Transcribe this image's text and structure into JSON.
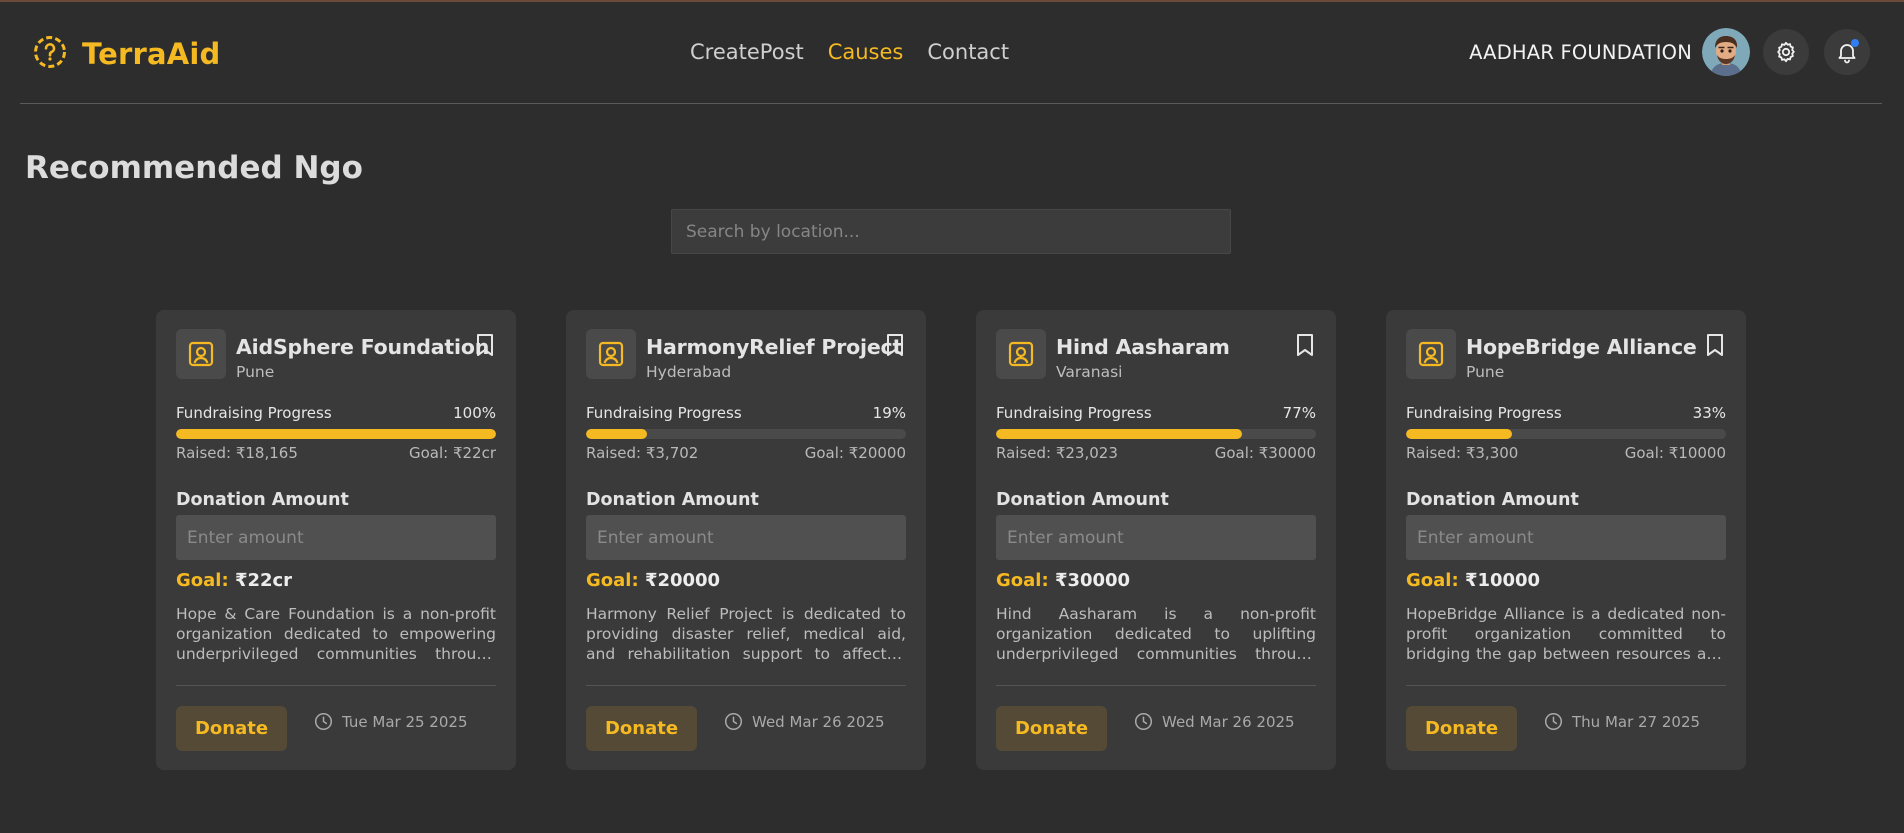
{
  "brand": {
    "name": "TerraAid"
  },
  "nav": [
    {
      "label": "CreatePost"
    },
    {
      "label": "Causes"
    },
    {
      "label": "Contact"
    }
  ],
  "user": {
    "name": "AADHAR FOUNDATION"
  },
  "page": {
    "title": "Recommended Ngo",
    "search_placeholder": "Search by location..."
  },
  "cards": [
    {
      "title": "AidSphere Foundation",
      "location": "Pune",
      "progress_label": "Fundraising Progress",
      "percent": "100%",
      "progress": 1.0,
      "raised": "Raised: ₹18,165",
      "goal_short": "Goal: ₹22cr",
      "donation_label": "Donation Amount",
      "amount_placeholder": "Enter amount",
      "goal_label": "Goal:",
      "goal_value": "₹22cr",
      "description": "Hope & Care Foundation is a non-profit organization dedicated to empowering underprivileged communities through education, healthcare and sustainable development.",
      "donate_label": "Donate",
      "date": "Tue Mar 25 2025"
    },
    {
      "title": "HarmonyRelief Project",
      "location": "Hyderabad",
      "progress_label": "Fundraising Progress",
      "percent": "19%",
      "progress": 0.19,
      "raised": "Raised: ₹3,702",
      "goal_short": "Goal: ₹20000",
      "donation_label": "Donation Amount",
      "amount_placeholder": "Enter amount",
      "goal_label": "Goal:",
      "goal_value": "₹20000",
      "description": "Harmony Relief Project is dedicated to providing disaster relief, medical aid, and rehabilitation support to affected communities across the region.",
      "donate_label": "Donate",
      "date": "Wed Mar 26 2025"
    },
    {
      "title": "Hind Aasharam",
      "location": "Varanasi",
      "progress_label": "Fundraising Progress",
      "percent": "77%",
      "progress": 0.77,
      "raised": "Raised: ₹23,023",
      "goal_short": "Goal: ₹30000",
      "donation_label": "Donation Amount",
      "amount_placeholder": "Enter amount",
      "goal_label": "Goal:",
      "goal_value": "₹30000",
      "description": "Hind Aasharam is a non-profit organization dedicated to uplifting underprivileged communities through shelter, education and care for the elderly.",
      "donate_label": "Donate",
      "date": "Wed Mar 26 2025"
    },
    {
      "title": "HopeBridge Alliance",
      "location": "Pune",
      "progress_label": "Fundraising Progress",
      "percent": "33%",
      "progress": 0.33,
      "raised": "Raised: ₹3,300",
      "goal_short": "Goal: ₹10000",
      "donation_label": "Donation Amount",
      "amount_placeholder": "Enter amount",
      "goal_label": "Goal:",
      "goal_value": "₹10000",
      "description": "HopeBridge Alliance is a dedicated non-profit organization committed to bridging the gap between resources and the communities that need them most.",
      "donate_label": "Donate",
      "date": "Thu Mar 27 2025"
    }
  ],
  "colors": {
    "accent": "#f5b922",
    "background": "#2d2d2d",
    "card": "#3a3a3a",
    "notification_dot": "#2f7ef6"
  },
  "icons": [
    "help-circle-icon",
    "avatar-icon",
    "gear-icon",
    "bell-icon",
    "user-square-icon",
    "bookmark-icon",
    "clock-icon"
  ]
}
